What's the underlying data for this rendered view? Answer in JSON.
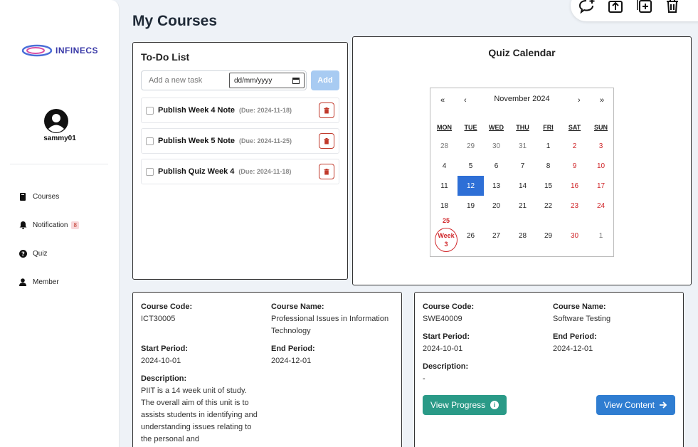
{
  "brand": {
    "logo_text": "INFINECS"
  },
  "user": {
    "username": "sammy01"
  },
  "nav": {
    "items": [
      {
        "label": "Courses",
        "icon": "book-icon"
      },
      {
        "label": "Notification",
        "icon": "bell-icon",
        "badge": "8"
      },
      {
        "label": "Quiz",
        "icon": "question-circle-icon"
      },
      {
        "label": "Member",
        "icon": "person-icon"
      }
    ]
  },
  "page": {
    "title": "My Courses"
  },
  "todo": {
    "title": "To-Do List",
    "input_placeholder": "Add a new task",
    "date_placeholder": "dd/mm/yyyy",
    "add_label": "Add",
    "items": [
      {
        "title": "Publish Week 4 Note",
        "due": "(Due: 2024-11-18)"
      },
      {
        "title": "Publish Week 5 Note",
        "due": "(Due: 2024-11-25)"
      },
      {
        "title": "Publish Quiz Week 4",
        "due": "(Due: 2024-11-18)"
      }
    ]
  },
  "calendar": {
    "title": "Quiz Calendar",
    "month_label": "November 2024",
    "nav": {
      "prev_year": "«",
      "prev_month": "‹",
      "next_month": "›",
      "next_year": "»"
    },
    "weekdays": [
      "MON",
      "TUE",
      "WED",
      "THU",
      "FRI",
      "SAT",
      "SUN"
    ],
    "weeks": [
      [
        "28",
        "29",
        "30",
        "31",
        "1",
        "2",
        "3"
      ],
      [
        "4",
        "5",
        "6",
        "7",
        "8",
        "9",
        "10"
      ],
      [
        "11",
        "12",
        "13",
        "14",
        "15",
        "16",
        "17"
      ],
      [
        "18",
        "19",
        "20",
        "21",
        "22",
        "23",
        "24"
      ],
      [
        "25",
        "26",
        "27",
        "28",
        "29",
        "30",
        "1"
      ]
    ],
    "selected_date": "12",
    "week_marker": {
      "day": "25",
      "line1": "Week",
      "line2": "3"
    }
  },
  "courses": [
    {
      "code_label": "Course Code:",
      "code": "ICT30005",
      "name_label": "Course Name:",
      "name": "Professional Issues in Information Technology",
      "start_label": "Start Period:",
      "start": "2024-10-01",
      "end_label": "End Period:",
      "end": "2024-12-01",
      "desc_label": "Description:",
      "description": "PIIT is a 14 week unit of study. The overall aim of this unit is to assists students in identifying and understanding issues relating to the personal and"
    },
    {
      "code_label": "Course Code:",
      "code": "SWE40009",
      "name_label": "Course Name:",
      "name": "Software Testing",
      "start_label": "Start Period:",
      "start": "2024-10-01",
      "end_label": "End Period:",
      "end": "2024-12-01",
      "desc_label": "Description:",
      "description": "-",
      "progress_label": "View Progress",
      "content_label": "View Content"
    }
  ],
  "colors": {
    "primary": "#2f7dd1",
    "teal": "#2a9a87",
    "danger": "#d0262a",
    "today": "#2e6fd6"
  }
}
